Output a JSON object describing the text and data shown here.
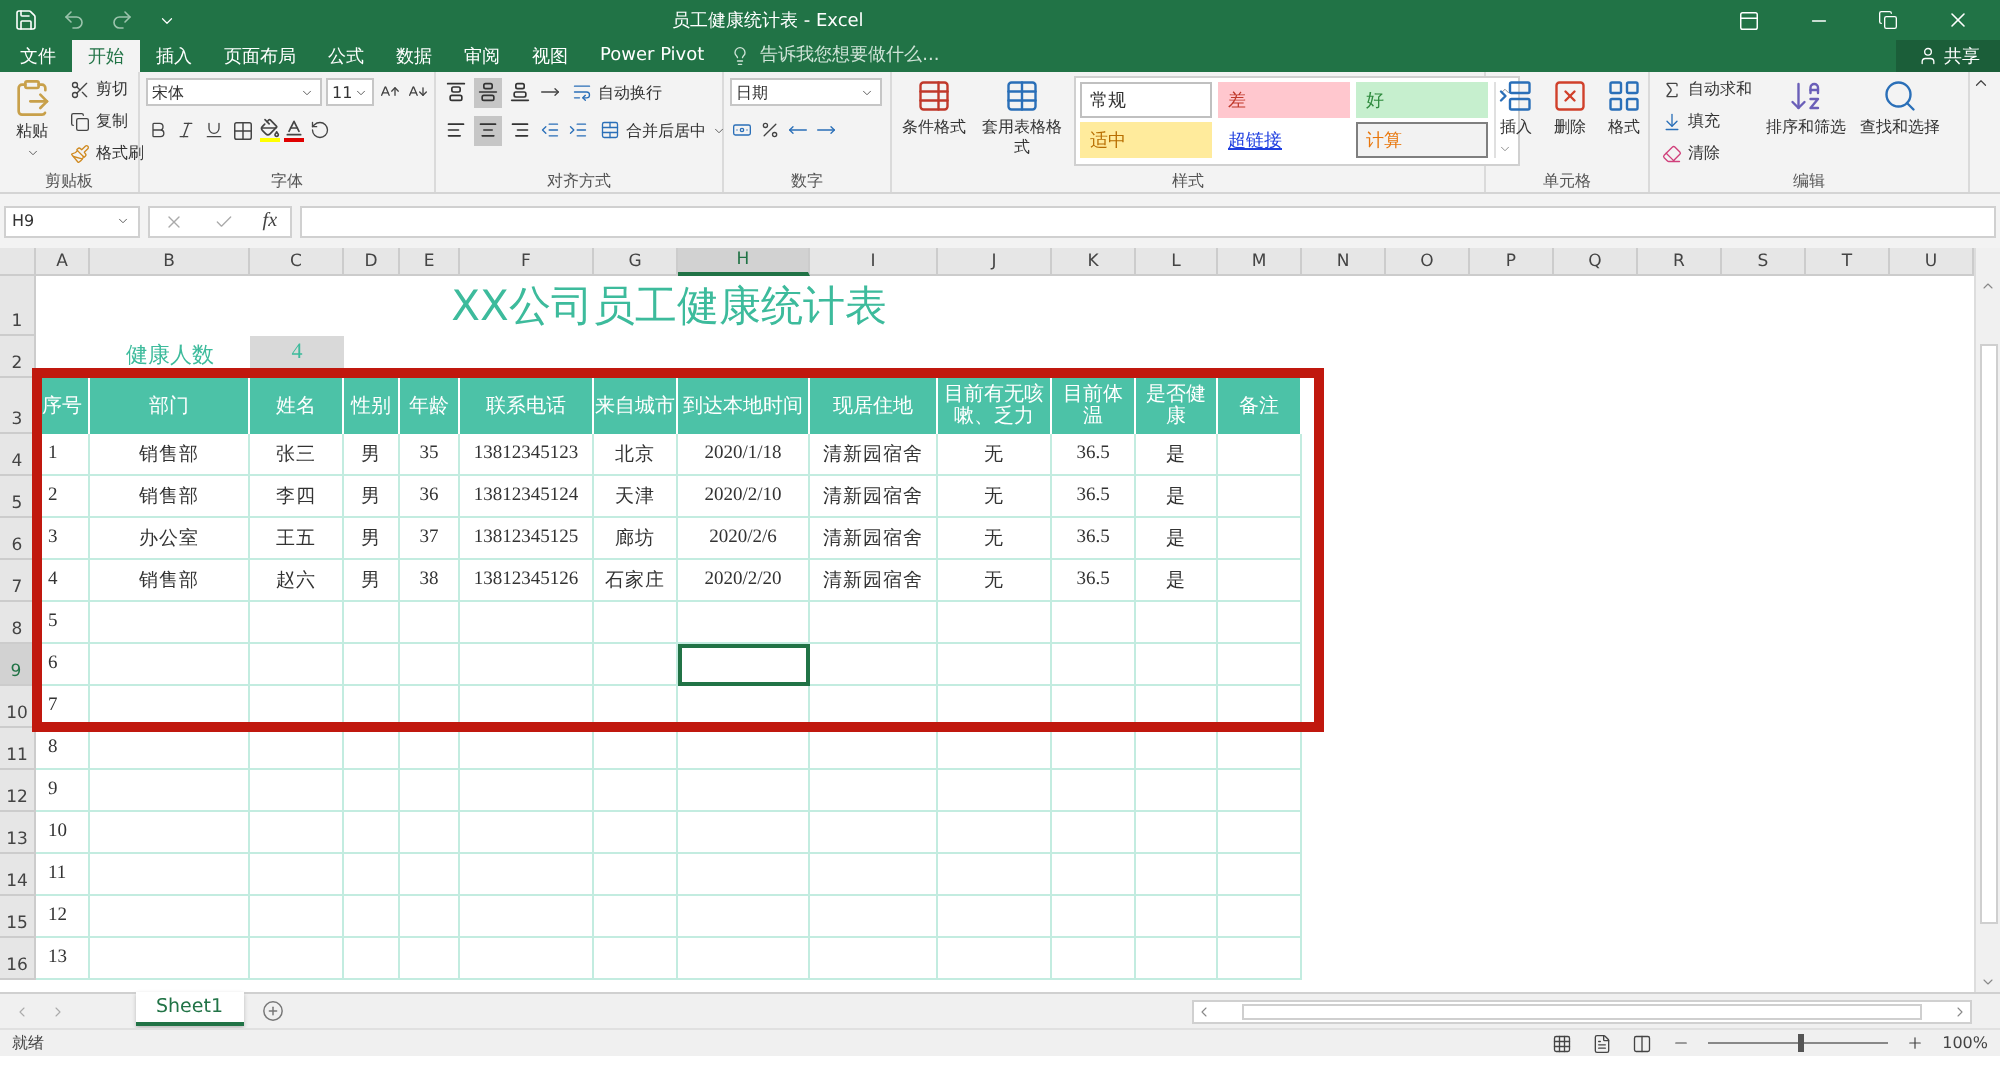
{
  "window": {
    "title": "员工健康统计表 - Excel"
  },
  "ribbon_tabs": [
    {
      "label": "文件",
      "selected": false
    },
    {
      "label": "开始",
      "selected": true
    },
    {
      "label": "插入",
      "selected": false
    },
    {
      "label": "页面布局",
      "selected": false
    },
    {
      "label": "公式",
      "selected": false
    },
    {
      "label": "数据",
      "selected": false
    },
    {
      "label": "审阅",
      "selected": false
    },
    {
      "label": "视图",
      "selected": false
    },
    {
      "label": "Power Pivot",
      "selected": false
    }
  ],
  "tell_me": {
    "placeholder": "告诉我您想要做什么..."
  },
  "share": {
    "label": "共享"
  },
  "clipboard": {
    "paste": "粘贴",
    "cut": "剪切",
    "copy": "复制",
    "format_painter": "格式刷",
    "label": "剪贴板"
  },
  "font": {
    "name": "宋体",
    "size": "11",
    "label": "字体"
  },
  "alignment": {
    "wrap": "自动换行",
    "merge": "合并后居中",
    "label": "对齐方式",
    "vertical": [
      {
        "selected": false
      },
      {
        "selected": true
      },
      {
        "selected": false
      }
    ],
    "horizontal": [
      {
        "selected": false
      },
      {
        "selected": true
      },
      {
        "selected": false
      }
    ]
  },
  "number": {
    "format": "日期",
    "label": "数字"
  },
  "styles": {
    "conditional": "条件格式",
    "table_format": "套用表格格式",
    "label": "样式",
    "gallery": [
      {
        "label": "常规",
        "kind": "normal"
      },
      {
        "label": "差",
        "kind": "bad"
      },
      {
        "label": "好",
        "kind": "good"
      },
      {
        "label": "适中",
        "kind": "neutral"
      },
      {
        "label": "超链接",
        "kind": "link"
      },
      {
        "label": "计算",
        "kind": "calculation"
      }
    ]
  },
  "cells": {
    "insert": "插入",
    "delete": "删除",
    "format": "格式",
    "label": "单元格"
  },
  "editing": {
    "autosum": "自动求和",
    "fill": "填充",
    "clear": "清除",
    "sort": "排序和筛选",
    "find": "查找和选择",
    "label": "编辑"
  },
  "formula_bar": {
    "name_box": "H9",
    "function_label": "fx"
  },
  "sheet": {
    "columns": [
      {
        "label": "A",
        "selected": false
      },
      {
        "label": "B",
        "selected": false
      },
      {
        "label": "C",
        "selected": false
      },
      {
        "label": "D",
        "selected": false
      },
      {
        "label": "E",
        "selected": false
      },
      {
        "label": "F",
        "selected": false
      },
      {
        "label": "G",
        "selected": false
      },
      {
        "label": "H",
        "selected": true
      },
      {
        "label": "I",
        "selected": false
      },
      {
        "label": "J",
        "selected": false
      },
      {
        "label": "K",
        "selected": false
      },
      {
        "label": "L",
        "selected": false
      },
      {
        "label": "M",
        "selected": false
      },
      {
        "label": "N",
        "selected": false
      },
      {
        "label": "O",
        "selected": false
      },
      {
        "label": "P",
        "selected": false
      },
      {
        "label": "Q",
        "selected": false
      },
      {
        "label": "R",
        "selected": false
      },
      {
        "label": "S",
        "selected": false
      },
      {
        "label": "T",
        "selected": false
      },
      {
        "label": "U",
        "selected": false
      }
    ],
    "rows": [
      {
        "label": "1",
        "selected": false
      },
      {
        "label": "2",
        "selected": false
      },
      {
        "label": "3",
        "selected": false
      },
      {
        "label": "4",
        "selected": false
      },
      {
        "label": "5",
        "selected": false
      },
      {
        "label": "6",
        "selected": false
      },
      {
        "label": "7",
        "selected": false
      },
      {
        "label": "8",
        "selected": false
      },
      {
        "label": "9",
        "selected": true
      },
      {
        "label": "10",
        "selected": false
      },
      {
        "label": "11",
        "selected": false
      },
      {
        "label": "12",
        "selected": false
      },
      {
        "label": "13",
        "selected": false
      },
      {
        "label": "14",
        "selected": false
      },
      {
        "label": "15",
        "selected": false
      },
      {
        "label": "16",
        "selected": false
      }
    ],
    "title": "XX公司员工健康统计表",
    "summary": {
      "label": "健康人数",
      "value": "4"
    },
    "table": {
      "header": [
        "序号",
        "部门",
        "姓名",
        "性别",
        "年龄",
        "联系电话",
        "来自城市",
        "到达本地时间",
        "现居住地",
        "目前有无咳嗽、乏力",
        "目前体温",
        "是否健康",
        "备注"
      ],
      "rows": [
        {
          "cells": [
            "1",
            "销售部",
            "张三",
            "男",
            "35",
            "13812345123",
            "北京",
            "2020/1/18",
            "清新园宿舍",
            "无",
            "36.5",
            "是"
          ]
        },
        {
          "cells": [
            "2",
            "销售部",
            "李四",
            "男",
            "36",
            "13812345124",
            "天津",
            "2020/2/10",
            "清新园宿舍",
            "无",
            "36.5",
            "是"
          ]
        },
        {
          "cells": [
            "3",
            "办公室",
            "王五",
            "男",
            "37",
            "13812345125",
            "廊坊",
            "2020/2/6",
            "清新园宿舍",
            "无",
            "36.5",
            "是"
          ]
        },
        {
          "cells": [
            "4",
            "销售部",
            "赵六",
            "男",
            "38",
            "13812345126",
            "石家庄",
            "2020/2/20",
            "清新园宿舍",
            "无",
            "36.5",
            "是"
          ]
        },
        {
          "cells": [
            "5"
          ]
        },
        {
          "cells": [
            "6"
          ]
        },
        {
          "cells": [
            "7"
          ]
        },
        {
          "cells": [
            "8"
          ]
        },
        {
          "cells": [
            "9"
          ]
        },
        {
          "cells": [
            "10"
          ]
        },
        {
          "cells": [
            "11"
          ]
        },
        {
          "cells": [
            "12"
          ]
        },
        {
          "cells": [
            "13"
          ]
        }
      ]
    }
  },
  "sheet_tabs": [
    {
      "label": "Sheet1",
      "selected": true
    }
  ],
  "status_bar": {
    "status": "就绪",
    "zoom": "100%",
    "zoom_slider": {
      "level": 0.5
    }
  }
}
